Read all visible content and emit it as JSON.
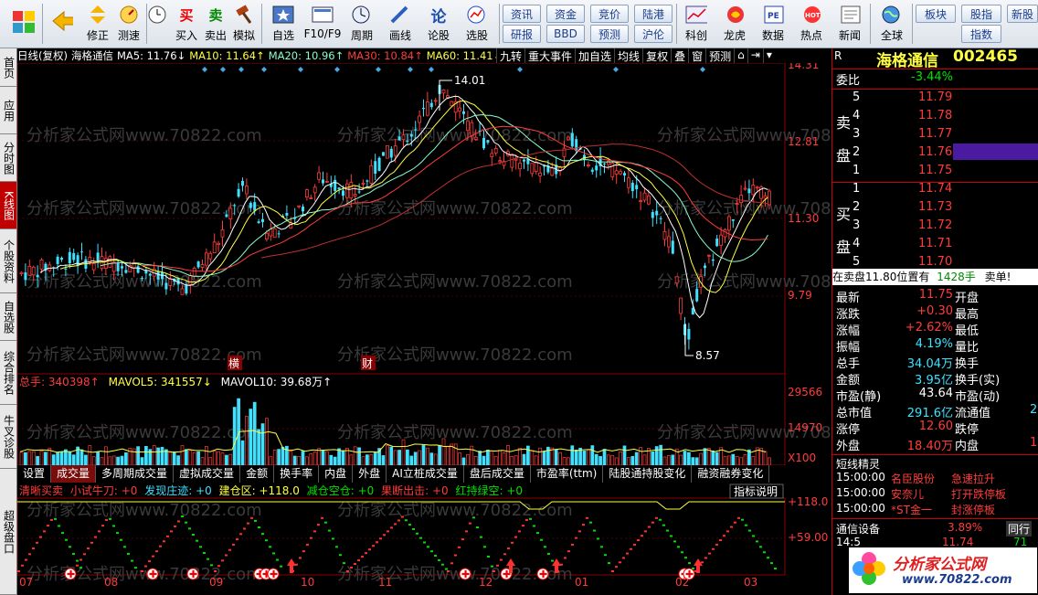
{
  "toolbar": {
    "buttons": [
      {
        "label": "",
        "icon": "windows-logo-icon"
      },
      {
        "label": "",
        "icon": "back-arrow-icon"
      },
      {
        "label": "修正",
        "icon": "up-down-arrow-icon"
      },
      {
        "label": "测速",
        "icon": "speed-test-icon"
      },
      {
        "label": "买入",
        "icon": "buy-icon",
        "glyph": "买"
      },
      {
        "label": "卖出",
        "icon": "sell-icon",
        "glyph": "卖"
      },
      {
        "label": "模拟",
        "icon": "hammer-icon"
      },
      {
        "label": "自选",
        "icon": "star-icon"
      },
      {
        "label": "F10/F9",
        "icon": "f10-icon"
      },
      {
        "label": "周期",
        "icon": "clock-icon"
      },
      {
        "label": "画线",
        "icon": "pencil-icon"
      },
      {
        "label": "论股",
        "icon": "forum-icon"
      },
      {
        "label": "选股",
        "icon": "stock-select-icon"
      },
      {
        "label": "科创",
        "icon": "kechuang-icon"
      },
      {
        "label": "龙虎",
        "icon": "dragon-tiger-icon"
      },
      {
        "label": "数据",
        "icon": "pe-icon"
      },
      {
        "label": "热点",
        "icon": "hot-icon"
      },
      {
        "label": "新闻",
        "icon": "news-icon"
      },
      {
        "label": "全球",
        "icon": "globe-icon"
      }
    ],
    "small_buttons": [
      "资讯",
      "资金",
      "竞价",
      "陆港",
      "研报",
      "BBD",
      "预测",
      "沪伦"
    ],
    "right_buttons": [
      "板块",
      "股指",
      "新股",
      "指数"
    ]
  },
  "sidebar": [
    "首页",
    "应用",
    "分时图",
    "K线图",
    "个股资料",
    "自选股",
    "综合排名",
    "牛叉诊股",
    "超级盘口"
  ],
  "sidebar_active": 3,
  "chart_header": {
    "mode": "日线(复权)",
    "name": "海格通信",
    "ma5": "MA5: 11.76↓",
    "ma10": "MA10: 11.64↑",
    "ma20": "MA20: 10.96↑",
    "ma30": "MA30: 10.84↑",
    "ma60": "MA60: 11.41↓"
  },
  "chart_tabs": [
    "九转",
    "重大事件",
    "加自选",
    "均线",
    "复权",
    "叠",
    "窗",
    "预测"
  ],
  "price_axis": [
    "14.31",
    "12.81",
    "11.30",
    "9.79"
  ],
  "price_labels": {
    "high": "14.01",
    "low": "8.57"
  },
  "markers": [
    "横",
    "财"
  ],
  "volume_header": {
    "total": "总手: 340398↑",
    "mavol5": "MAVOL5: 341557↓",
    "mavol10": "MAVOL10: 39.68万↑"
  },
  "volume_axis": [
    "29566",
    "14970",
    "X100"
  ],
  "volume_tabs": [
    "设置",
    "成交量",
    "多周期成交量",
    "虚拟成交量",
    "金额",
    "换手率",
    "内盘",
    "外盘",
    "AI立桩成交量",
    "盘后成交量",
    "市盈率(ttm)",
    "陆股通持股变化",
    "融资融券变化"
  ],
  "volume_tab_active": 1,
  "indicator_header": [
    {
      "text": "清晰买卖",
      "color": "red"
    },
    {
      "text": "小试牛刀: +0",
      "color": "red"
    },
    {
      "text": "发现庄迹: +0",
      "color": "cyan"
    },
    {
      "text": "建仓区: +118.0",
      "color": "yellow"
    },
    {
      "text": "减仓空仓: +0",
      "color": "green"
    },
    {
      "text": "果断出击: +0",
      "color": "red"
    },
    {
      "text": "红持绿空: +0",
      "color": "green"
    }
  ],
  "indicator_button": "指标说明",
  "indicator_axis": [
    "+118.0",
    "+59.00"
  ],
  "x_axis_months": [
    "07",
    "08",
    "09",
    "10",
    "11",
    "12",
    "01",
    "02",
    "03"
  ],
  "watermark": "分析家公式网www.70822.com",
  "stock": {
    "name": "海格通信",
    "code": "002465"
  },
  "order_book": {
    "webi_label": "委比",
    "webi": "-3.44%",
    "sell_label": [
      "卖",
      "盘"
    ],
    "buy_label": [
      "买",
      "盘"
    ],
    "sell": [
      {
        "n": "5",
        "p": "11.79"
      },
      {
        "n": "4",
        "p": "11.78"
      },
      {
        "n": "3",
        "p": "11.77"
      },
      {
        "n": "2",
        "p": "11.76"
      },
      {
        "n": "1",
        "p": "11.75"
      }
    ],
    "buy": [
      {
        "n": "1",
        "p": "11.74"
      },
      {
        "n": "2",
        "p": "11.73"
      },
      {
        "n": "3",
        "p": "11.72"
      },
      {
        "n": "4",
        "p": "11.71"
      },
      {
        "n": "5",
        "p": "11.70"
      }
    ],
    "notice": {
      "a": "在卖盘11.80位置有",
      "b": "1428手",
      "c": "卖单!"
    }
  },
  "quote": [
    {
      "l": "最新",
      "v": "11.75",
      "r": "开盘",
      "vc": "red"
    },
    {
      "l": "涨跌",
      "v": "+0.30",
      "r": "最高",
      "vc": "red"
    },
    {
      "l": "涨幅",
      "v": "+2.62%",
      "r": "最低",
      "vc": "red"
    },
    {
      "l": "振幅",
      "v": "4.19%",
      "r": "量比",
      "vc": "cyan"
    },
    {
      "l": "总手",
      "v": "34.04万",
      "r": "换手",
      "vc": "cyan"
    },
    {
      "l": "金额",
      "v": "3.95亿",
      "r": "换手(实)",
      "vc": "cyan"
    },
    {
      "l": "市盈(静)",
      "v": "43.64",
      "r": "市盈(动)",
      "vc": "white"
    },
    {
      "l": "总市值",
      "v": "291.6亿",
      "r": "流通值",
      "vc": "cyan",
      "extra": "2"
    },
    {
      "l": "涨停",
      "v": "12.60",
      "r": "跌停",
      "vc": "red"
    },
    {
      "l": "外盘",
      "v": "18.40万",
      "r": "内盘",
      "vc": "red",
      "extra": "1"
    }
  ],
  "spirit": {
    "title": "短线精灵",
    "items": [
      {
        "t": "15:00:00",
        "n": "名臣股份",
        "a": "急速拉升"
      },
      {
        "t": "15:00:00",
        "n": "安奈儿",
        "a": "打开跌停板"
      },
      {
        "t": "15:00:00",
        "n": "*ST金一",
        "a": "封涨停板"
      }
    ]
  },
  "footer": {
    "a": "通信设备",
    "b": "3.89%",
    "c": "同行"
  },
  "ticker": {
    "a": "14:5",
    "b": "11.74",
    "c": "71"
  },
  "logo_text": "分析家公式网",
  "logo_url": "www.70822.com",
  "colors": {
    "up": "#ff3c3c",
    "down": "#00e0ff",
    "bg": "#000000",
    "grid": "#8b0000"
  }
}
